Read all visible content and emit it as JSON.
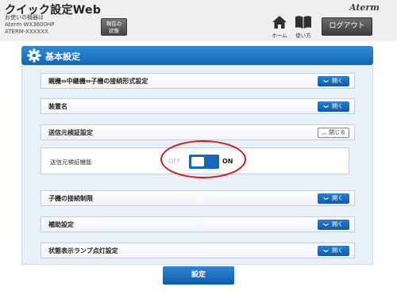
{
  "header": {
    "app_title": "クイック設定Web",
    "device_caption": "お使いの機器は",
    "device_model": "Aterm WX3600HP",
    "device_id": "ATERM-XXXXXX",
    "status_button": [
      "現在の",
      "状態"
    ],
    "logo": "Aterm",
    "home_label": "ホーム",
    "manual_label": "使い方",
    "logout_label": "ログアウト"
  },
  "panel": {
    "title": "基本設定",
    "sections": [
      {
        "title": "親機⇔中継機⇔子機の接続形式設定",
        "button": "開く",
        "state": "closed"
      },
      {
        "title": "装置名",
        "button": "開く",
        "state": "closed"
      },
      {
        "title": "送信元検証設定",
        "button": "閉じる",
        "state": "open"
      },
      {
        "title": "子機の接続制限",
        "button": "開く",
        "state": "closed"
      },
      {
        "title": "補助設定",
        "button": "開く",
        "state": "closed"
      },
      {
        "title": "状態表示ランプ点灯設定",
        "button": "開く",
        "state": "closed"
      }
    ],
    "source_verification": {
      "label": "送信元検証機能",
      "off_label": "OFF",
      "on_label": "ON",
      "value": "ON"
    }
  },
  "submit_label": "設定",
  "colors": {
    "accent_blue": "#1565b6",
    "highlight_red": "#e1141c"
  }
}
